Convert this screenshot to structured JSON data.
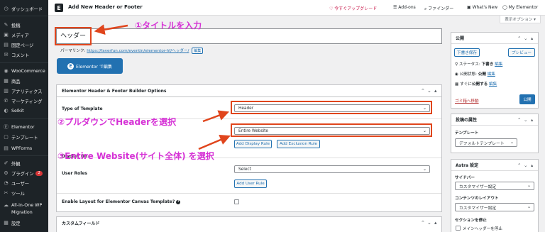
{
  "sidebar": {
    "items": [
      {
        "icon": "dashboard-icon",
        "glyph": "◷",
        "label": "ダッシュボード"
      },
      {
        "icon": "pin-icon",
        "glyph": "✎",
        "label": "投稿"
      },
      {
        "icon": "media-icon",
        "glyph": "▣",
        "label": "メディア"
      },
      {
        "icon": "page-icon",
        "glyph": "▤",
        "label": "固定ページ"
      },
      {
        "icon": "comment-icon",
        "glyph": "✉",
        "label": "コメント"
      },
      {
        "icon": "woocommerce-icon",
        "glyph": "◉",
        "label": "WooCommerce"
      },
      {
        "icon": "products-icon",
        "glyph": "▦",
        "label": "商品"
      },
      {
        "icon": "analytics-icon",
        "glyph": "▥",
        "label": "アナリティクス"
      },
      {
        "icon": "marketing-icon",
        "glyph": "✆",
        "label": "マーケティング"
      },
      {
        "icon": "seokit-icon",
        "glyph": "◐",
        "label": "SeIkit"
      },
      {
        "icon": "elementor-icon",
        "glyph": "Ⓔ",
        "label": "Elementor"
      },
      {
        "icon": "templates-icon",
        "glyph": "▢",
        "label": "テンプレート"
      },
      {
        "icon": "wpforms-icon",
        "glyph": "▤",
        "label": "WPForms"
      },
      {
        "icon": "appearance-icon",
        "glyph": "✐",
        "label": "外観"
      },
      {
        "icon": "plugins-icon",
        "glyph": "⚙",
        "label": "プラグイン",
        "badge": "2"
      },
      {
        "icon": "users-icon",
        "glyph": "◔",
        "label": "ユーザー"
      },
      {
        "icon": "tools-icon",
        "glyph": "✂",
        "label": "ツール"
      },
      {
        "icon": "migration-icon",
        "glyph": "☁",
        "label": "All-in-One WP"
      },
      {
        "icon": "",
        "glyph": "",
        "label": "Migration"
      },
      {
        "icon": "settings-icon",
        "glyph": "▦",
        "label": "設定"
      }
    ]
  },
  "topbar": {
    "logo": "E",
    "title": "Add New Header or Footer",
    "upgrade": "♡ 今すぐアップグレード",
    "addons": "☰ Add-ons",
    "finder": "⌕ ファインダー",
    "whats_new": "▣ What's New",
    "my_elementor": "◯ My Elementor"
  },
  "screen_options": "表示オプション ▾",
  "post_title": "ヘッダー",
  "permalink": {
    "label": "パーマリンク:",
    "url": "https://faverfun.com/eventin/elementor-hf/ヘッダー/",
    "edit": "編集"
  },
  "elementor_button": {
    "icon": "E",
    "label": "Elementor で編集"
  },
  "options_box": {
    "title": "Elementor Header & Footer Builder Options",
    "type_label": "Type of Template",
    "type_value": "Header",
    "display_label": "Display On",
    "display_value": "Entire Website",
    "add_display_rule": "Add Display Rule",
    "add_exclusion_rule": "Add Exclusion Rule",
    "user_roles_label": "User Roles",
    "user_roles_value": "Select",
    "add_user_rule": "Add User Rule",
    "canvas_label": "Enable Layout for Elementor Canvas Template?",
    "help": "?"
  },
  "custom_fields": {
    "title": "カスタムフィールド"
  },
  "publish": {
    "title": "公開",
    "save_draft": "下書き保存",
    "preview": "プレビュー",
    "status": "ステータス: ",
    "status_value": "下書き",
    "visibility": "公開状態: ",
    "visibility_value": "公開",
    "schedule": "すぐに",
    "schedule_suffix": "公開する",
    "edit": "編集",
    "trash": "ゴミ箱へ移動",
    "publish_btn": "公開"
  },
  "attributes": {
    "title": "投稿の属性",
    "template_label": "テンプレート",
    "template_value": "デフォルトテンプレート"
  },
  "astra": {
    "title": "Astra 設定",
    "sidebar_label": "サイドバー",
    "sidebar_value": "カスタマイザー設定",
    "content_label": "コンテンツのレイアウト",
    "content_value": "カスタマイザー設定",
    "disable_label": "セクションを停止",
    "main_header": "メインヘッダーを停止"
  },
  "annotations": {
    "step1": "①タイトルを入力",
    "step2": "②プルダウンでHeaderを選択",
    "step3": "③Entire Website(サイト全体) を選択"
  },
  "colors": {
    "annotation": "#d633d6",
    "highlight_box": "#e0451c",
    "wp_blue": "#2271b1",
    "sidebar_bg": "#1d2327"
  }
}
